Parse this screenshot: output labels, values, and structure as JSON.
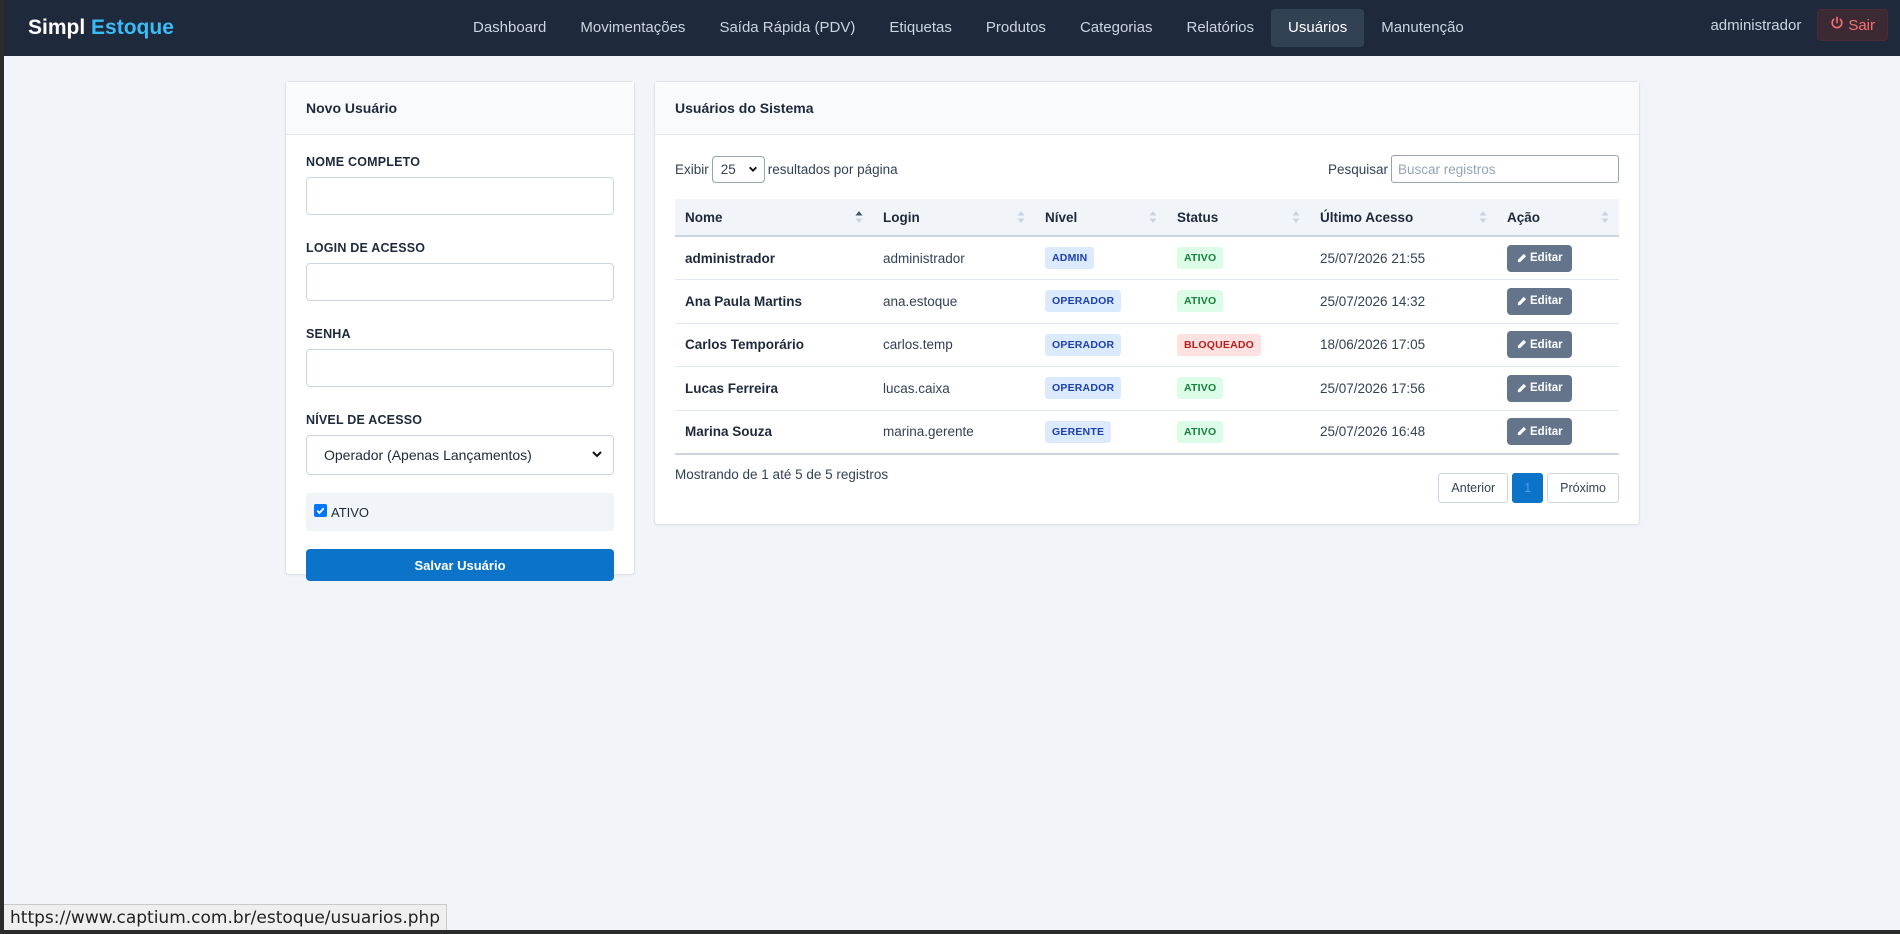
{
  "brand": {
    "part1": "Simpl",
    "part2": "Estoque"
  },
  "nav": {
    "items": [
      {
        "label": "Dashboard"
      },
      {
        "label": "Movimentações"
      },
      {
        "label": "Saída Rápida (PDV)"
      },
      {
        "label": "Etiquetas"
      },
      {
        "label": "Produtos"
      },
      {
        "label": "Categorias"
      },
      {
        "label": "Relatórios"
      },
      {
        "label": "Usuários"
      },
      {
        "label": "Manutenção"
      }
    ],
    "active": "Usuários",
    "user": "administrador",
    "logout": "Sair"
  },
  "form": {
    "title": "Novo Usuário",
    "name_label": "NOME COMPLETO",
    "name_value": "",
    "login_label": "LOGIN DE ACESSO",
    "login_value": "",
    "password_label": "SENHA",
    "password_value": "",
    "level_label": "NÍVEL DE ACESSO",
    "level_value": "Operador (Apenas Lançamentos)",
    "active_label": "ATIVO",
    "active_checked": true,
    "save_label": "Salvar Usuário"
  },
  "list": {
    "title": "Usuários do Sistema",
    "show_prefix": "Exibir",
    "page_size": "25",
    "show_suffix": "resultados por página",
    "search_label": "Pesquisar",
    "search_placeholder": "Buscar registros",
    "columns": [
      "Nome",
      "Login",
      "Nível",
      "Status",
      "Último Acesso",
      "Ação"
    ],
    "rows": [
      {
        "name": "administrador",
        "login": "administrador",
        "level": "ADMIN",
        "status": "ATIVO",
        "last": "25/07/2026 21:55",
        "action": "Editar"
      },
      {
        "name": "Ana Paula Martins",
        "login": "ana.estoque",
        "level": "OPERADOR",
        "status": "ATIVO",
        "last": "25/07/2026 14:32",
        "action": "Editar"
      },
      {
        "name": "Carlos Temporário",
        "login": "carlos.temp",
        "level": "OPERADOR",
        "status": "BLOQUEADO",
        "last": "18/06/2026 17:05",
        "action": "Editar"
      },
      {
        "name": "Lucas Ferreira",
        "login": "lucas.caixa",
        "level": "OPERADOR",
        "status": "ATIVO",
        "last": "25/07/2026 17:56",
        "action": "Editar"
      },
      {
        "name": "Marina Souza",
        "login": "marina.gerente",
        "level": "GERENTE",
        "status": "ATIVO",
        "last": "25/07/2026 16:48",
        "action": "Editar"
      }
    ],
    "info": "Mostrando de 1 até 5 de 5 registros",
    "prev": "Anterior",
    "page": "1",
    "next": "Próximo"
  },
  "statusbar": {
    "url": "https://www.captium.com.br/estoque/usuarios.php"
  },
  "colors": {
    "navbar": "#1e293b",
    "primary": "#0b74c8",
    "accent": "#38bdf8",
    "danger": "#f87171"
  }
}
